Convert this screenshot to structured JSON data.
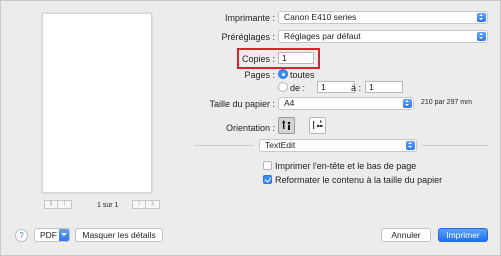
{
  "preview": {
    "page_indicator": "1 sur 1",
    "first_icon": "first-page-icon",
    "prev_icon": "previous-page-icon",
    "next_icon": "next-page-icon",
    "last_icon": "last-page-icon"
  },
  "printer": {
    "label": "Imprimante :",
    "value": "Canon E410 series"
  },
  "presets": {
    "label": "Préréglages :",
    "value": "Réglages par défaut"
  },
  "copies": {
    "label": "Copies :",
    "value": "1"
  },
  "pages": {
    "label": "Pages :",
    "all_label": "toutes",
    "range_label": "de :",
    "from_value": "1",
    "to_label": "à :",
    "to_value": "1"
  },
  "paper_size": {
    "label": "Taille du papier :",
    "value": "A4",
    "dimensions": "210 par 297 mm"
  },
  "orientation": {
    "label": "Orientation :"
  },
  "app_section": {
    "value": "TextEdit"
  },
  "options": [
    {
      "label": "Imprimer l'en-tête et le bas de page",
      "checked": false
    },
    {
      "label": "Reformater le contenu à la taille du papier",
      "checked": true
    }
  ],
  "footer": {
    "help": "?",
    "pdf_label": "PDF",
    "hide_details_label": "Masquer les détails",
    "cancel_label": "Annuler",
    "print_label": "Imprimer"
  },
  "colors": {
    "accent": "#2f7cf6",
    "highlight": "#d6262b"
  }
}
